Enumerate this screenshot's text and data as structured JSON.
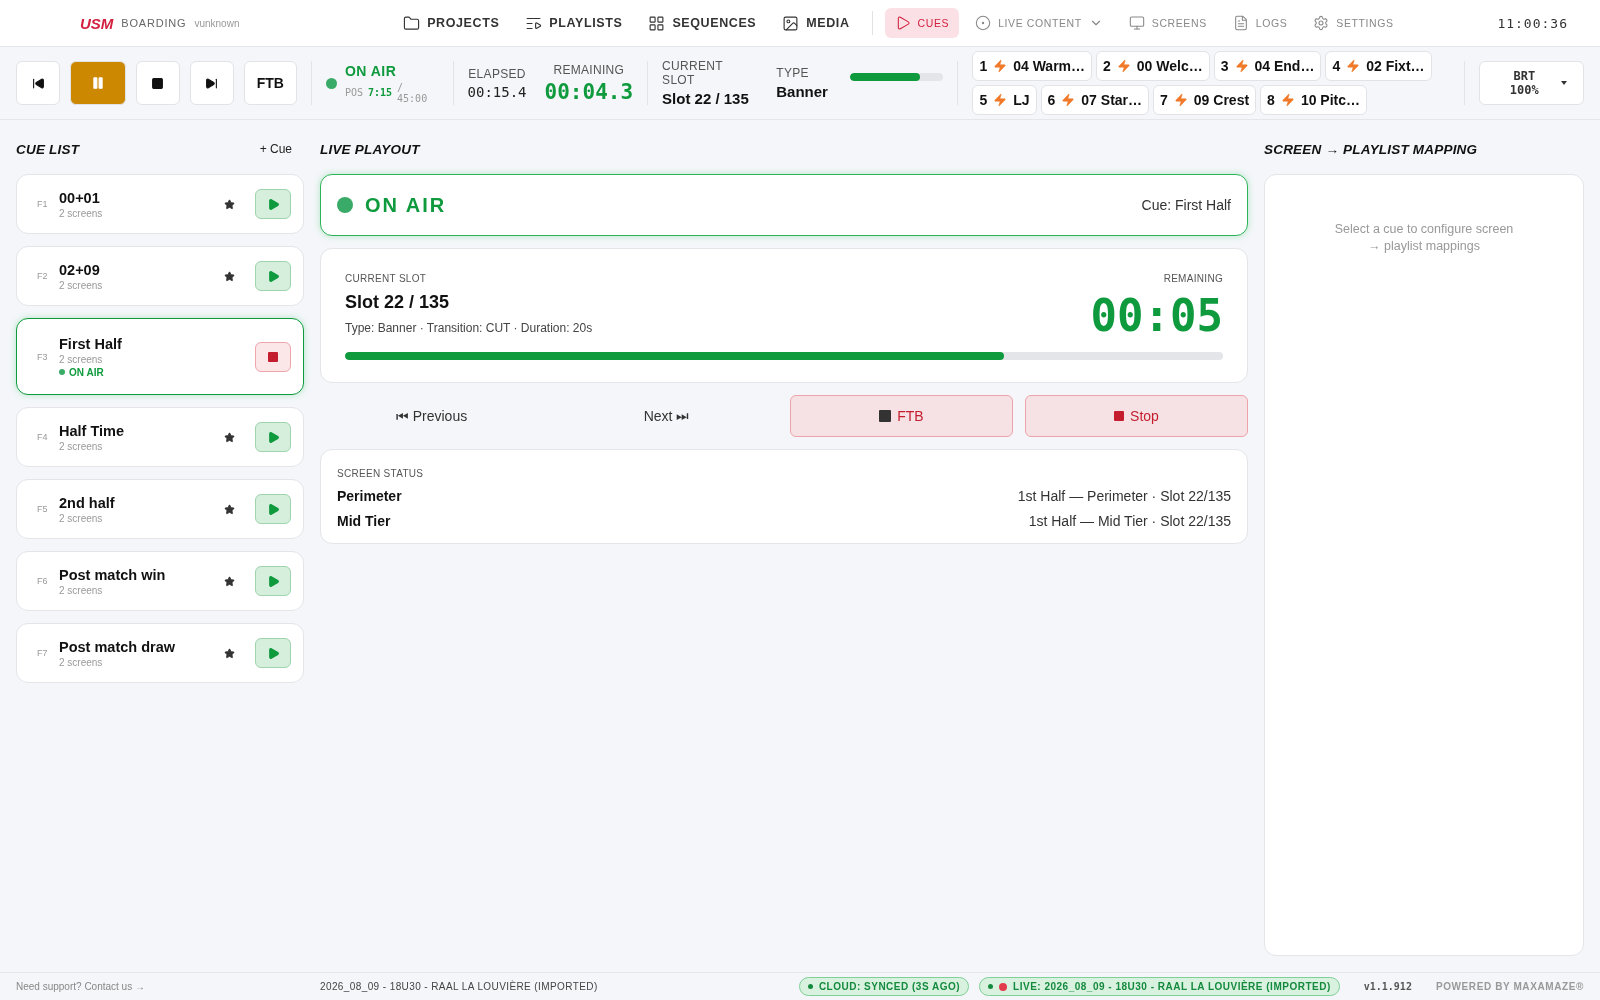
{
  "header": {
    "logo": "USM",
    "product": "BOARDING",
    "user": "vunknown",
    "clock": "11:00:36",
    "nav": [
      {
        "label": "PROJECTS",
        "kind": "main",
        "selected": false
      },
      {
        "label": "PLAYLISTS",
        "kind": "main",
        "selected": false
      },
      {
        "label": "SEQUENCES",
        "kind": "main",
        "selected": false
      },
      {
        "label": "MEDIA",
        "kind": "main",
        "selected": false
      },
      {
        "label": "CUES",
        "kind": "live",
        "selected": true
      },
      {
        "label": "LIVE CONTENT",
        "kind": "menu",
        "selected": false
      },
      {
        "label": "SCREENS",
        "kind": "live",
        "selected": false
      },
      {
        "label": "LOGS",
        "kind": "live",
        "selected": false
      },
      {
        "label": "SETTINGS",
        "kind": "live",
        "selected": false
      }
    ]
  },
  "transport": {
    "buttons": [
      {
        "kind": "previous",
        "active": false
      },
      {
        "kind": "pause",
        "active": true
      },
      {
        "kind": "stop",
        "active": false
      },
      {
        "kind": "next",
        "active": false
      },
      {
        "kind": "text",
        "label": "FTB",
        "active": false
      }
    ],
    "status": {
      "label": "ON AIR",
      "pos_label": "POS",
      "pos": "7:15",
      "duration": "/ 45:00"
    },
    "elapsed": {
      "label": "ELAPSED",
      "value": "00:15.4"
    },
    "remaining": {
      "label": "REMAINING",
      "value": "00:04.3"
    },
    "slot": {
      "label": "CURRENT SLOT",
      "value": "Slot 22 / 135"
    },
    "type": {
      "label": "TYPE",
      "value": "Banner"
    },
    "progress": {
      "level": 0.75
    },
    "quick_cues": [
      {
        "number": "1",
        "label": "04 Warm…"
      },
      {
        "number": "2",
        "label": "00 Welc…"
      },
      {
        "number": "3",
        "label": "04 End…"
      },
      {
        "number": "4",
        "label": "02 Fixt…"
      },
      {
        "number": "5",
        "label": "LJ"
      },
      {
        "number": "6",
        "label": "07 Star…"
      },
      {
        "number": "7",
        "label": "09 Crest"
      },
      {
        "number": "8",
        "label": "10 Pitc…"
      }
    ],
    "brightness": "BRT 100%"
  },
  "cue_list": {
    "title": "CUE LIST",
    "add": "+ Cue",
    "cues": [
      {
        "key": "F1",
        "name": "00+01",
        "screens": "2 screens",
        "on_air": false,
        "starred": true
      },
      {
        "key": "F2",
        "name": "02+09",
        "screens": "2 screens",
        "on_air": false,
        "starred": true
      },
      {
        "key": "F3",
        "name": "First Half",
        "screens": "2 screens",
        "on_air": true,
        "status": "ON AIR",
        "starred": false
      },
      {
        "key": "F4",
        "name": "Half Time",
        "screens": "2 screens",
        "on_air": false,
        "starred": true
      },
      {
        "key": "F5",
        "name": "2nd half",
        "screens": "2 screens",
        "on_air": false,
        "starred": true
      },
      {
        "key": "F6",
        "name": "Post match win",
        "screens": "2 screens",
        "on_air": false,
        "starred": true
      },
      {
        "key": "F7",
        "name": "Post match draw",
        "screens": "2 screens",
        "on_air": false,
        "starred": true
      }
    ]
  },
  "live_playout": {
    "title": "LIVE PLAYOUT",
    "banner": {
      "status": "ON AIR",
      "cue": "Cue: First Half"
    },
    "slot_card": {
      "label": "CURRENT SLOT",
      "name": "Slot 22 / 135",
      "details": "Type: Banner · Transition: CUT · Duration: 20s",
      "remaining_label": "REMAINING",
      "remaining": "00:05",
      "level": 0.75
    },
    "controls": {
      "previous": "⏮ Previous",
      "next": "Next ⏭",
      "ftb": "FTB",
      "stop": "Stop"
    },
    "screen_status": {
      "title": "SCREEN STATUS",
      "rows": [
        {
          "name": "Perimeter",
          "value": "1st Half — Perimeter · Slot 22/135"
        },
        {
          "name": "Mid Tier",
          "value": "1st Half — Mid Tier · Slot 22/135"
        }
      ]
    }
  },
  "mapping": {
    "title": "SCREEN → PLAYLIST MAPPING",
    "placeholder": "Select a cue to configure screen → playlist mappings"
  },
  "status_bar": {
    "support": "Need support? Contact us →",
    "project": "2026_08_09 - 18U30 - RAAL LA LOUVIÈRE (IMPORTED)",
    "cloud": "CLOUD: SYNCED (3S AGO)",
    "live": "LIVE: 2026_08_09 - 18U30 - RAAL LA LOUVIÈRE (IMPORTED)",
    "version": "v1.1.912",
    "powered": "POWERED BY MAXAMAZE®"
  }
}
